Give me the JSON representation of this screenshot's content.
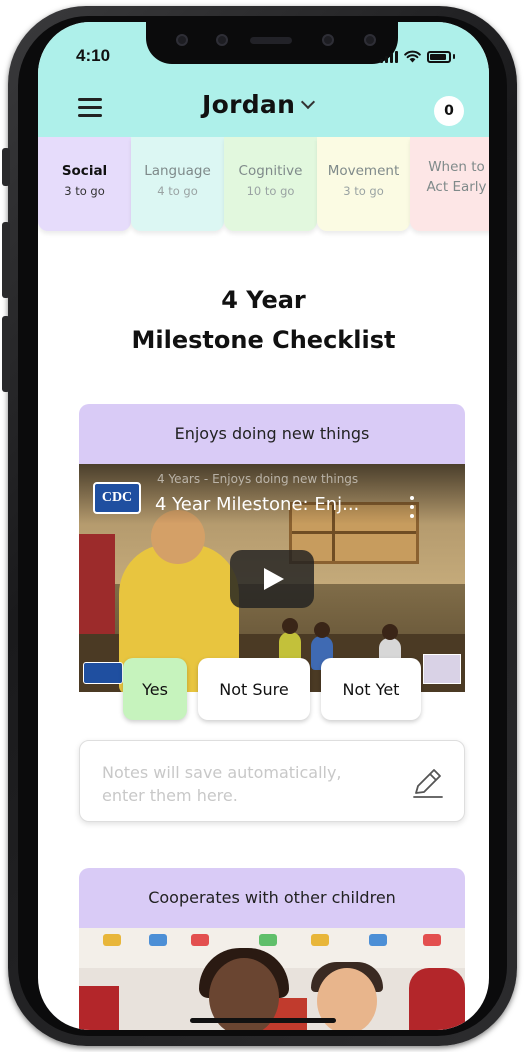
{
  "status_bar": {
    "time": "4:10"
  },
  "header": {
    "child_name": "Jordan",
    "count": "0"
  },
  "tabs": [
    {
      "label": "Social",
      "sub": "3 to go",
      "active": true
    },
    {
      "label": "Language",
      "sub": "4 to go",
      "active": false
    },
    {
      "label": "Cognitive",
      "sub": "10 to go",
      "active": false
    },
    {
      "label": "Movement",
      "sub": "3 to go",
      "active": false
    },
    {
      "label_line1": "When to",
      "label_line2": "Act Early",
      "active": false
    }
  ],
  "page_title": {
    "line1": "4 Year",
    "line2": "Milestone Checklist"
  },
  "milestones": [
    {
      "title": "Enjoys doing new things",
      "video": {
        "logo_text": "CDC",
        "subtitle": "4 Years - Enjoys doing new things",
        "title": "4 Year Milestone: Enj..."
      },
      "answers": {
        "yes": "Yes",
        "not_sure": "Not Sure",
        "not_yet": "Not Yet",
        "selected": "yes"
      },
      "notes_placeholder_line1": "Notes will save automatically,",
      "notes_placeholder_line2": "enter them here."
    },
    {
      "title": "Cooperates with other children"
    }
  ],
  "colors": {
    "header_bg": "#aef0ea",
    "card_header": "#d9cbf6",
    "selected_answer": "#c6f3bd",
    "tab_social": "#e6dcfb",
    "tab_language": "#dcf7f3",
    "tab_cognitive": "#e2f8de",
    "tab_movement": "#fbfbe3",
    "tab_act_early": "#fde6e6"
  }
}
